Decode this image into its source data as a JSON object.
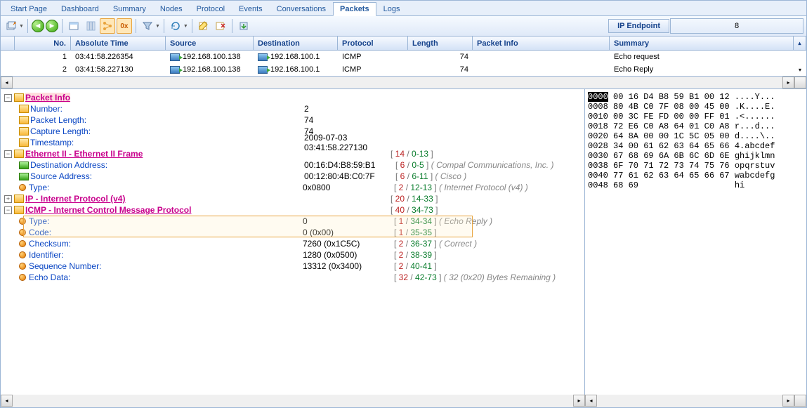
{
  "tabs": [
    "Start Page",
    "Dashboard",
    "Summary",
    "Nodes",
    "Protocol",
    "Events",
    "Conversations",
    "Packets",
    "Logs"
  ],
  "active_tab": "Packets",
  "toolbar": {
    "ip_endpoint_label": "IP Endpoint",
    "ip_endpoint_value": "8"
  },
  "grid": {
    "columns": [
      "No.",
      "Absolute Time",
      "Source",
      "Destination",
      "Protocol",
      "Length",
      "Packet Info",
      "Summary"
    ],
    "rows": [
      {
        "no": "1",
        "time": "03:41:58.226354",
        "src": "192.168.100.138",
        "dst": "192.168.100.1",
        "proto": "ICMP",
        "len": "74",
        "info": "",
        "summary": "Echo request"
      },
      {
        "no": "2",
        "time": "03:41:58.227130",
        "src": "192.168.100.138",
        "dst": "192.168.100.1",
        "proto": "ICMP",
        "len": "74",
        "info": "",
        "summary": "Echo Reply"
      }
    ]
  },
  "tree": {
    "packet_info": {
      "title": "Packet Info",
      "fields": [
        {
          "k": "Number:",
          "v": "2"
        },
        {
          "k": "Packet Length:",
          "v": "74"
        },
        {
          "k": "Capture Length:",
          "v": "74"
        },
        {
          "k": "Timestamp:",
          "v": "2009-07-03 03:41:58.227130"
        }
      ]
    },
    "eth": {
      "title": "Ethernet II - Ethernet II Frame",
      "range": {
        "s": "14",
        "r": "0-13"
      },
      "fields": [
        {
          "k": "Destination Address:",
          "v": "00:16:D4:B8:59:B1",
          "s": "6",
          "r": "0-5",
          "c": "( Compal Communications, Inc. )"
        },
        {
          "k": "Source Address:",
          "v": "00:12:80:4B:C0:7F",
          "s": "6",
          "r": "6-11",
          "c": "( Cisco )"
        },
        {
          "k": "Type:",
          "v": "0x0800",
          "s": "2",
          "r": "12-13",
          "c": "( Internet Protocol (v4) )"
        }
      ]
    },
    "ip": {
      "title": "IP - Internet Protocol (v4)",
      "range": {
        "s": "20",
        "r": "14-33"
      }
    },
    "icmp": {
      "title": "ICMP - Internet Control Message Protocol",
      "range": {
        "s": "40",
        "r": "34-73"
      },
      "fields": [
        {
          "k": "Type:",
          "v": "0",
          "s": "1",
          "r": "34-34",
          "c": "( Echo Reply )"
        },
        {
          "k": "Code:",
          "v": "0 (0x00)",
          "s": "1",
          "r": "35-35",
          "c": ""
        },
        {
          "k": "Checksum:",
          "v": "7260 (0x1C5C)",
          "s": "2",
          "r": "36-37",
          "c": "( Correct )"
        },
        {
          "k": "Identifier:",
          "v": "1280 (0x0500)",
          "s": "2",
          "r": "38-39",
          "c": ""
        },
        {
          "k": "Sequence Number:",
          "v": "13312 (0x3400)",
          "s": "2",
          "r": "40-41",
          "c": ""
        },
        {
          "k": "Echo Data:",
          "v": "",
          "s": "32",
          "r": "42-73",
          "c": "( 32 (0x20) Bytes Remaining )"
        }
      ]
    }
  },
  "hex": {
    "rows": [
      {
        "off": "0000",
        "by": "00 16 D4 B8 59 B1 00 12",
        "asc": "....Y..."
      },
      {
        "off": "0008",
        "by": "80 4B C0 7F 08 00 45 00",
        "asc": ".K....E."
      },
      {
        "off": "0010",
        "by": "00 3C FE FD 00 00 FF 01",
        "asc": ".<......"
      },
      {
        "off": "0018",
        "by": "72 E6 C0 A8 64 01 C0 A8",
        "asc": "r...d..."
      },
      {
        "off": "0020",
        "by": "64 8A 00 00 1C 5C 05 00",
        "asc": "d....\\.."
      },
      {
        "off": "0028",
        "by": "34 00 61 62 63 64 65 66",
        "asc": "4.abcdef"
      },
      {
        "off": "0030",
        "by": "67 68 69 6A 6B 6C 6D 6E",
        "asc": "ghijklmn"
      },
      {
        "off": "0038",
        "by": "6F 70 71 72 73 74 75 76",
        "asc": "opqrstuv"
      },
      {
        "off": "0040",
        "by": "77 61 62 63 64 65 66 67",
        "asc": "wabcdefg"
      },
      {
        "off": "0048",
        "by": "68 69                  ",
        "asc": "hi      "
      }
    ]
  }
}
